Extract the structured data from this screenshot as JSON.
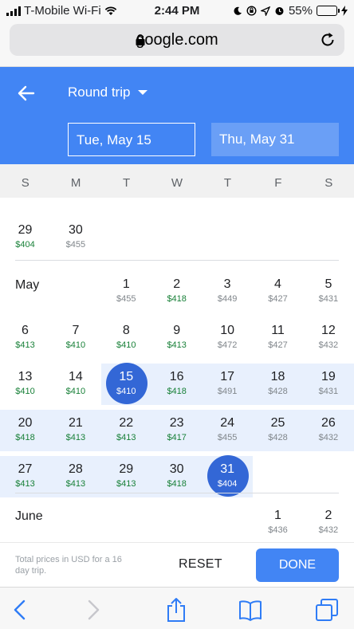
{
  "status_bar": {
    "carrier": "T-Mobile Wi-Fi",
    "time": "2:44 PM",
    "battery": "55%"
  },
  "browser": {
    "url": "google.com"
  },
  "header": {
    "trip_type": "Round trip",
    "depart_date": "Tue, May 15",
    "return_date": "Thu, May 31"
  },
  "weekdays": [
    "S",
    "M",
    "T",
    "W",
    "T",
    "F",
    "S"
  ],
  "calendar": {
    "april_tail": [
      {
        "day": "29",
        "price": "$404",
        "low": true
      },
      {
        "day": "30",
        "price": "$455",
        "low": false
      }
    ],
    "may": {
      "label": "May",
      "days": [
        {
          "day": "1",
          "price": "$455",
          "low": false
        },
        {
          "day": "2",
          "price": "$418",
          "low": true
        },
        {
          "day": "3",
          "price": "$449",
          "low": false
        },
        {
          "day": "4",
          "price": "$427",
          "low": false
        },
        {
          "day": "5",
          "price": "$431",
          "low": false
        },
        {
          "day": "6",
          "price": "$413",
          "low": true
        },
        {
          "day": "7",
          "price": "$410",
          "low": true
        },
        {
          "day": "8",
          "price": "$410",
          "low": true
        },
        {
          "day": "9",
          "price": "$413",
          "low": true
        },
        {
          "day": "10",
          "price": "$472",
          "low": false
        },
        {
          "day": "11",
          "price": "$427",
          "low": false
        },
        {
          "day": "12",
          "price": "$432",
          "low": false
        },
        {
          "day": "13",
          "price": "$410",
          "low": true
        },
        {
          "day": "14",
          "price": "$410",
          "low": true
        },
        {
          "day": "15",
          "price": "$410",
          "low": true
        },
        {
          "day": "16",
          "price": "$418",
          "low": true
        },
        {
          "day": "17",
          "price": "$491",
          "low": false
        },
        {
          "day": "18",
          "price": "$428",
          "low": false
        },
        {
          "day": "19",
          "price": "$431",
          "low": false
        },
        {
          "day": "20",
          "price": "$418",
          "low": true
        },
        {
          "day": "21",
          "price": "$413",
          "low": true
        },
        {
          "day": "22",
          "price": "$413",
          "low": true
        },
        {
          "day": "23",
          "price": "$417",
          "low": true
        },
        {
          "day": "24",
          "price": "$455",
          "low": false
        },
        {
          "day": "25",
          "price": "$428",
          "low": false
        },
        {
          "day": "26",
          "price": "$432",
          "low": false
        },
        {
          "day": "27",
          "price": "$413",
          "low": true
        },
        {
          "day": "28",
          "price": "$413",
          "low": true
        },
        {
          "day": "29",
          "price": "$413",
          "low": true
        },
        {
          "day": "30",
          "price": "$418",
          "low": true
        },
        {
          "day": "31",
          "price": "$404",
          "low": true
        }
      ]
    },
    "june": {
      "label": "June",
      "days": [
        {
          "day": "1",
          "price": "$436",
          "low": false
        },
        {
          "day": "2",
          "price": "$432",
          "low": false
        }
      ]
    },
    "selected_start": "15",
    "selected_end": "31"
  },
  "footer": {
    "note": "Total prices in USD for a 16 day trip.",
    "reset_label": "RESET",
    "done_label": "DONE"
  },
  "colors": {
    "header_blue": "#4285f4",
    "selected_blue": "#3367d6",
    "range_highlight": "#e8f0fd",
    "low_price_green": "#188038"
  }
}
